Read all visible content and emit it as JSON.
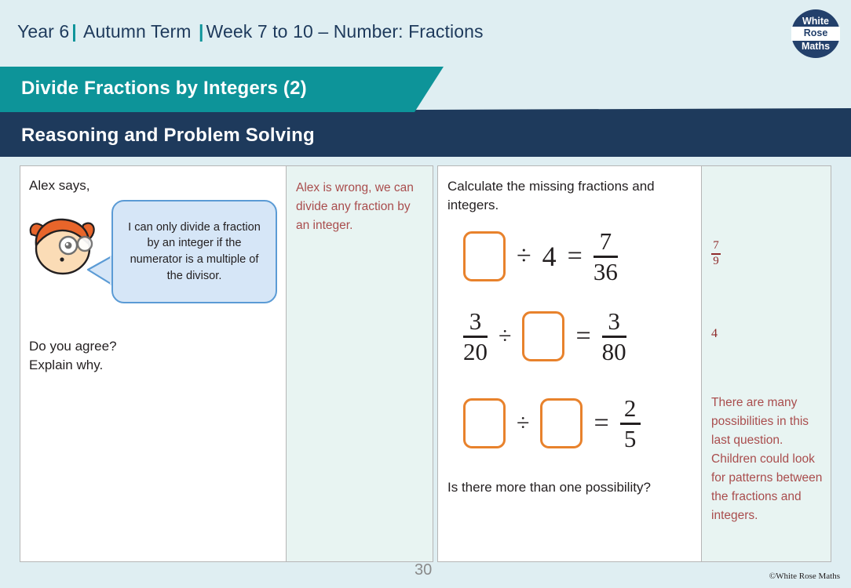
{
  "header": {
    "year": "Year 6",
    "term": "Autumn Term",
    "week": "Week 7 to 10 – Number: Fractions",
    "separator": "|",
    "logo": {
      "line1": "White",
      "line2": "Rose",
      "line3": "Maths"
    }
  },
  "banner": {
    "title": "Divide Fractions by Integers (2)",
    "subtitle": "Reasoning and Problem Solving",
    "teal_color": "#0d9499",
    "navy_color": "#1e3a5c"
  },
  "left_panel": {
    "prompt": "Alex says,",
    "speech_bubble": "I can only divide a fraction by an integer if the numerator is a multiple of the divisor.",
    "follow_up": "Do you agree?\nExplain why.",
    "answer": "Alex is wrong, we can divide any fraction by an integer."
  },
  "right_panel": {
    "instruction": "Calculate the missing fractions and integers.",
    "equations": [
      {
        "left": {
          "type": "blank"
        },
        "operator": "÷",
        "middle": {
          "type": "integer",
          "value": "4"
        },
        "equals": "=",
        "result": {
          "type": "fraction",
          "numerator": "7",
          "denominator": "36"
        }
      },
      {
        "left": {
          "type": "fraction",
          "numerator": "3",
          "denominator": "20"
        },
        "operator": "÷",
        "middle": {
          "type": "blank"
        },
        "equals": "=",
        "result": {
          "type": "fraction",
          "numerator": "3",
          "denominator": "80"
        }
      },
      {
        "left": {
          "type": "blank"
        },
        "operator": "÷",
        "middle": {
          "type": "blank"
        },
        "equals": "=",
        "result": {
          "type": "fraction",
          "numerator": "2",
          "denominator": "5"
        }
      }
    ],
    "possibility_question": "Is there more than one possibility?",
    "answers": {
      "q1_numerator": "7",
      "q1_denominator": "9",
      "q2": "4",
      "q3_note": "There are many possibilities in this last question. Children could look for patterns between the fractions and integers."
    }
  },
  "footer": {
    "page_number": "30",
    "copyright": "©White Rose Maths"
  },
  "colors": {
    "answer_text": "#a94d4d",
    "blank_box_border": "#e8822c",
    "bubble_fill": "#d6e6f7",
    "bubble_border": "#5b9bd5",
    "page_background": "#dfeef2",
    "answer_column_background": "#e8f4f2"
  }
}
